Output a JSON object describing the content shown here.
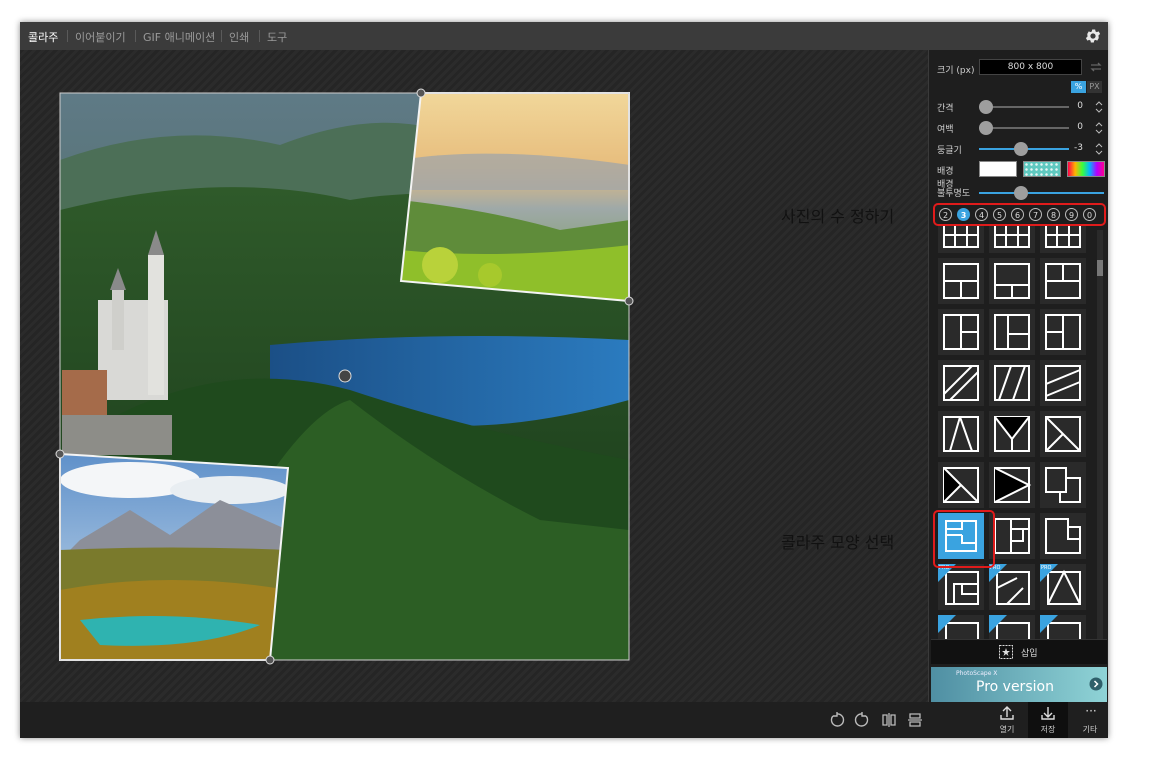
{
  "menu": {
    "items": [
      "콜라주",
      "이어붙이기",
      "GIF 애니메이션",
      "인쇄",
      "도구"
    ],
    "active_index": 0
  },
  "panel": {
    "size_label": "크기 (px)",
    "size_value": "800 x 800",
    "unit_percent": "%",
    "unit_px": "PX",
    "spacing_label": "간격",
    "spacing_value": "0",
    "margin_label": "여백",
    "margin_value": "0",
    "roundness_label": "둥글기",
    "roundness_value": "-3",
    "background_label": "배경",
    "bg_opacity_label_1": "배경",
    "bg_opacity_label_2": "불투명도",
    "photo_counts": [
      "2",
      "3",
      "4",
      "5",
      "6",
      "7",
      "8",
      "9",
      "0"
    ],
    "photo_count_selected": "3",
    "insert_label": "삽입",
    "pro_small": "PhotoScape X",
    "pro_label": "Pro version",
    "pro_badge": "PRO"
  },
  "bottom": {
    "open_label": "열기",
    "save_label": "저장",
    "more_label": "기타"
  },
  "callouts": {
    "photo_count": "사진의 수 정하기",
    "shape_select": "콜라주 모양 선택"
  },
  "colors": {
    "accent": "#3aa3e0",
    "highlight": "#e01b1b",
    "panel_bg": "#1e1e1e",
    "menubar_bg": "#3b3b3b"
  }
}
